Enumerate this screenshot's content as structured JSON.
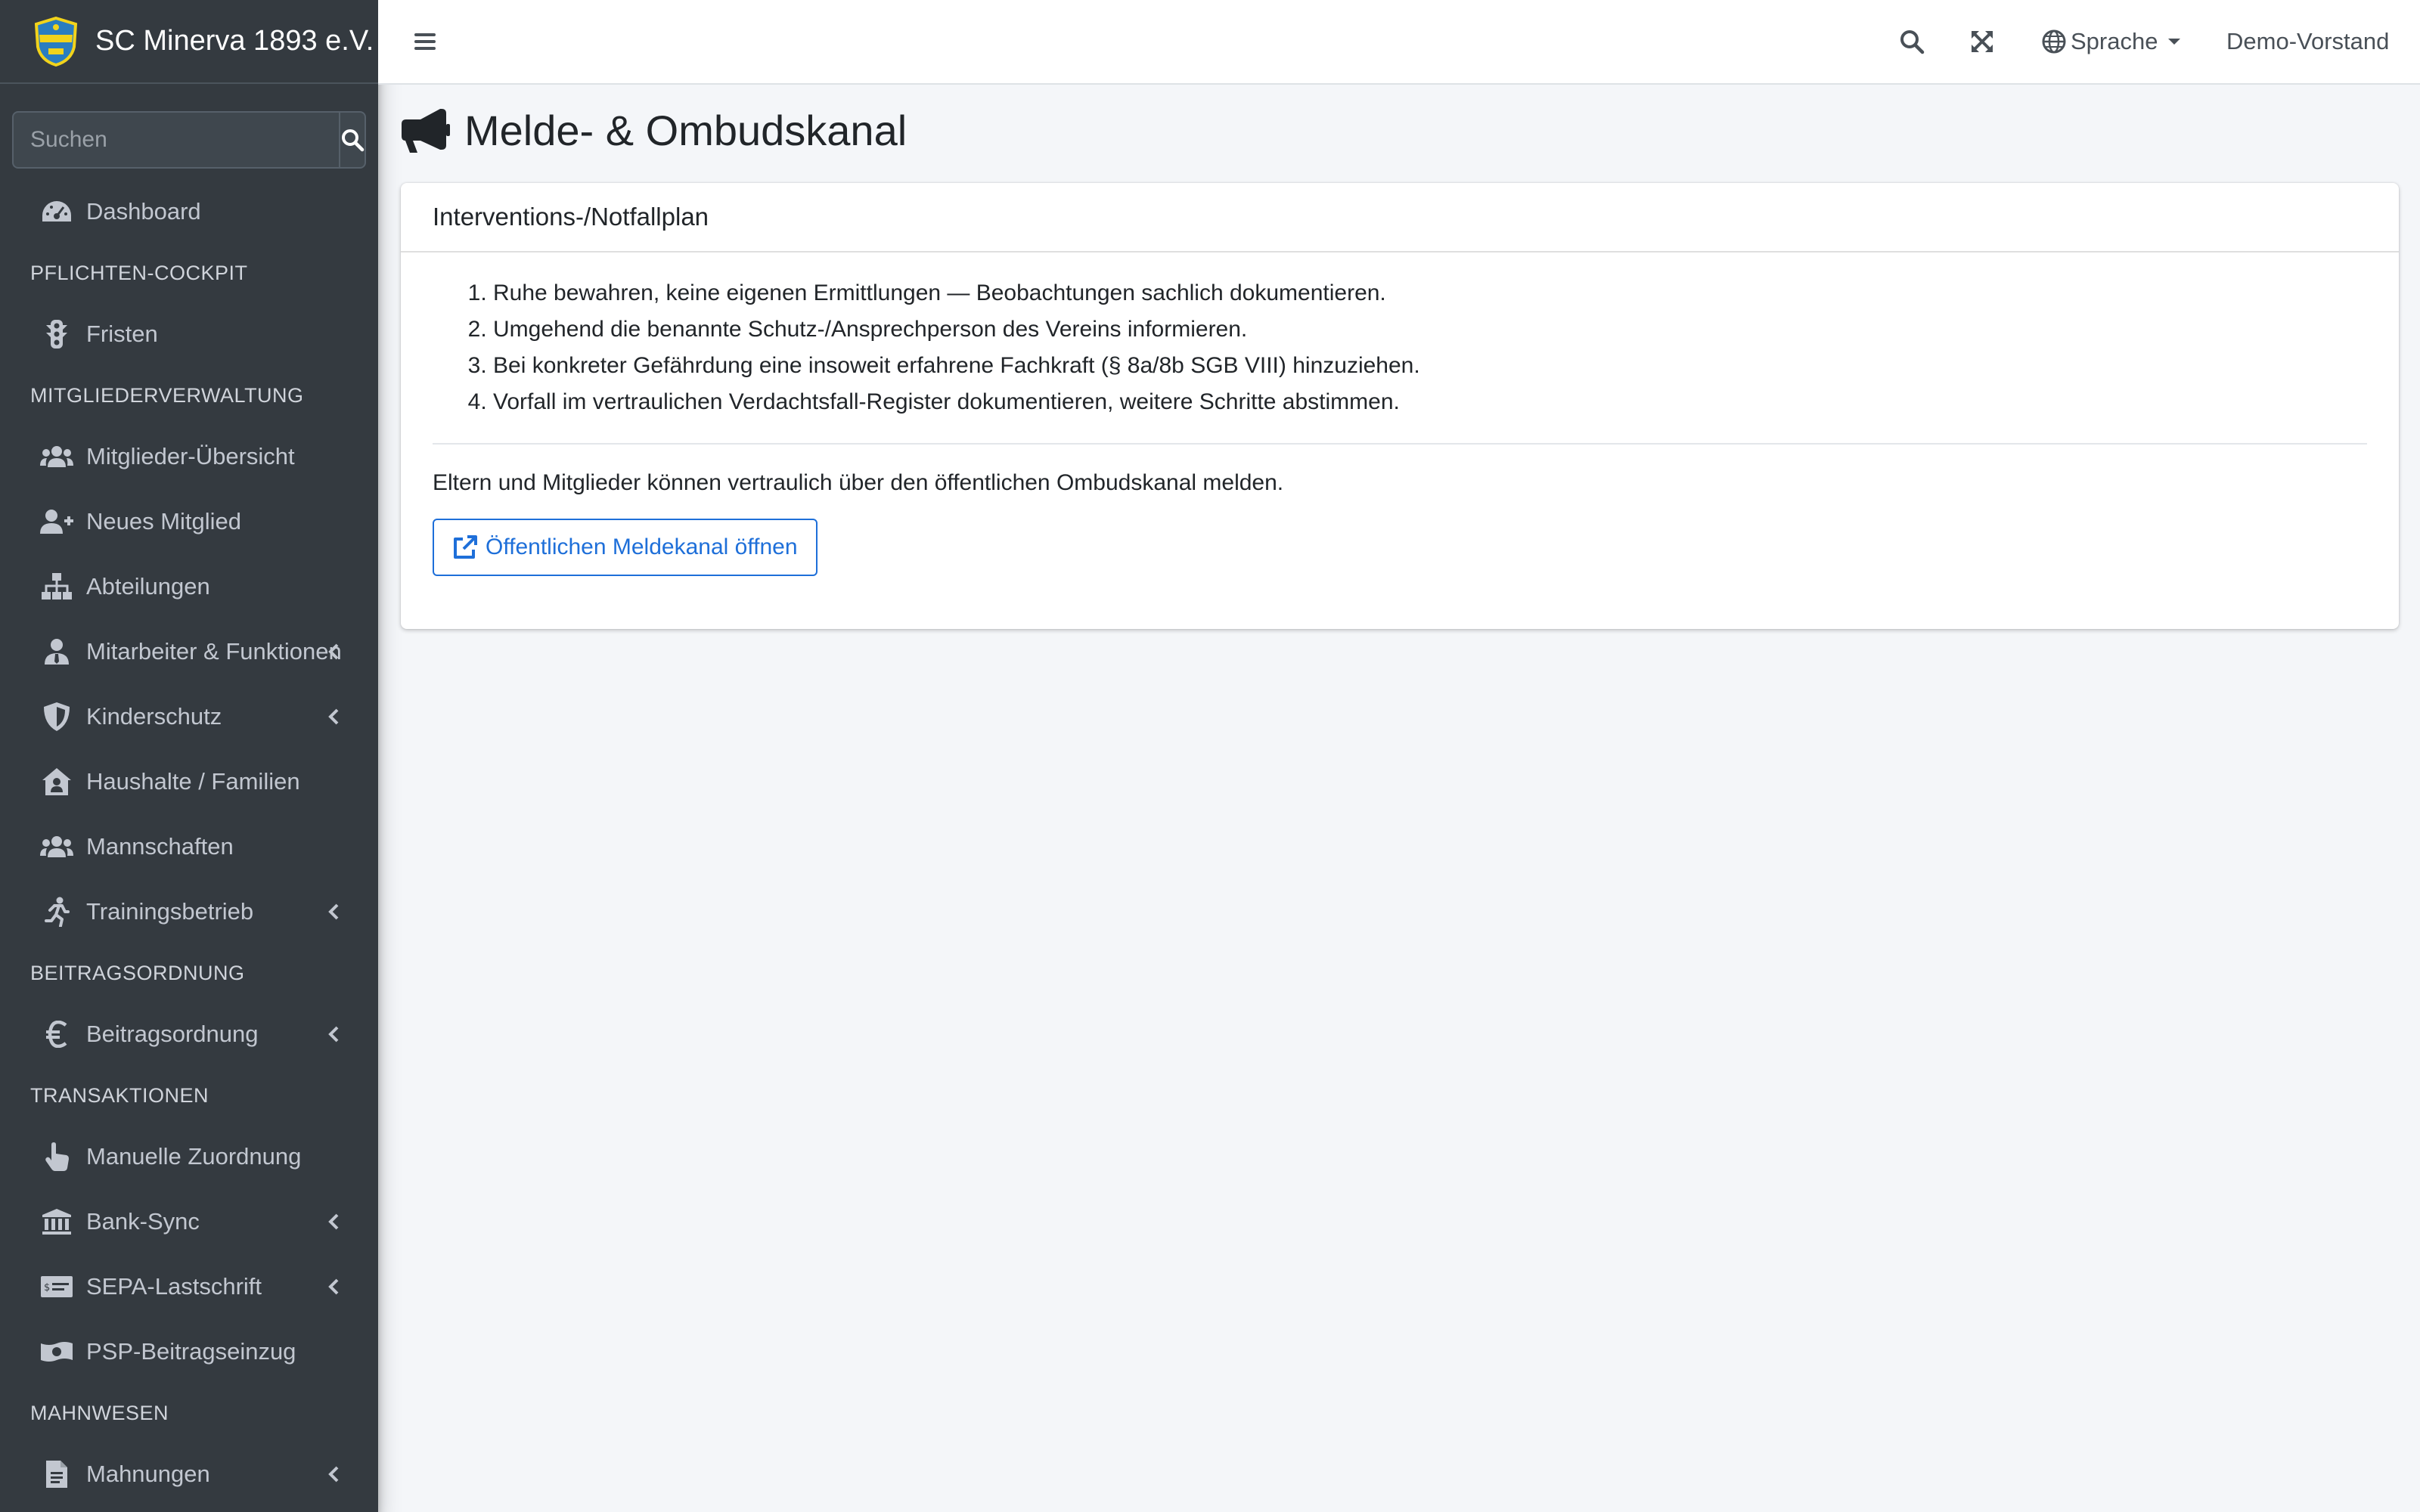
{
  "brand": {
    "name": "SC Minerva 1893 e.V."
  },
  "sidebar": {
    "search_placeholder": "Suchen",
    "items": [
      {
        "type": "item",
        "label": "Dashboard",
        "icon": "tachometer-icon",
        "chevron": false
      },
      {
        "type": "header",
        "label": "PFLICHTEN-COCKPIT"
      },
      {
        "type": "item",
        "label": "Fristen",
        "icon": "traffic-light-icon",
        "chevron": false
      },
      {
        "type": "header",
        "label": "MITGLIEDERVERWALTUNG"
      },
      {
        "type": "item",
        "label": "Mitglieder-Übersicht",
        "icon": "users-icon",
        "chevron": false
      },
      {
        "type": "item",
        "label": "Neues Mitglied",
        "icon": "user-plus-icon",
        "chevron": false
      },
      {
        "type": "item",
        "label": "Abteilungen",
        "icon": "sitemap-icon",
        "chevron": false
      },
      {
        "type": "item",
        "label": "Mitarbeiter & Funktionen",
        "icon": "user-tie-icon",
        "chevron": true
      },
      {
        "type": "item",
        "label": "Kinderschutz",
        "icon": "shield-icon",
        "chevron": true
      },
      {
        "type": "item",
        "label": "Haushalte / Familien",
        "icon": "house-user-icon",
        "chevron": false
      },
      {
        "type": "item",
        "label": "Mannschaften",
        "icon": "team-icon",
        "chevron": false
      },
      {
        "type": "item",
        "label": "Trainingsbetrieb",
        "icon": "running-icon",
        "chevron": true
      },
      {
        "type": "header",
        "label": "BEITRAGSORDNUNG"
      },
      {
        "type": "item",
        "label": "Beitragsordnung",
        "icon": "euro-icon",
        "chevron": true
      },
      {
        "type": "header",
        "label": "TRANSAKTIONEN"
      },
      {
        "type": "item",
        "label": "Manuelle Zuordnung",
        "icon": "hand-pointer-icon",
        "chevron": false
      },
      {
        "type": "item",
        "label": "Bank-Sync",
        "icon": "bank-icon",
        "chevron": true
      },
      {
        "type": "item",
        "label": "SEPA-Lastschrift",
        "icon": "money-check-icon",
        "chevron": true
      },
      {
        "type": "item",
        "label": "PSP-Beitragseinzug",
        "icon": "money-bill-icon",
        "chevron": false
      },
      {
        "type": "header",
        "label": "MAHNWESEN"
      },
      {
        "type": "item",
        "label": "Mahnungen",
        "icon": "file-alt-icon",
        "chevron": true
      }
    ]
  },
  "topbar": {
    "language_label": "Sprache",
    "user_label": "Demo-Vorstand"
  },
  "page": {
    "title": "Melde- & Ombudskanal",
    "card_title": "Interventions-/Notfallplan",
    "plan_steps": [
      "Ruhe bewahren, keine eigenen Ermittlungen — Beobachtungen sachlich dokumentieren.",
      "Umgehend die benannte Schutz-/Ansprechperson des Vereins informieren.",
      "Bei konkreter Gefährdung eine insoweit erfahrene Fachkraft (§ 8a/8b SGB VIII) hinzuziehen.",
      "Vorfall im vertraulichen Verdachtsfall-Register dokumentieren, weitere Schritte abstimmen."
    ],
    "description": "Eltern und Mitglieder können vertraulich über den öffentlichen Ombudskanal melden.",
    "open_button_label": "Öffentlichen Meldekanal öffnen"
  },
  "colors": {
    "sidebar_bg": "#343a40",
    "sidebar_text": "#c2c7d0",
    "content_bg": "#f4f6f9",
    "primary": "#1e6fd9",
    "logo_yellow": "#f2d31b",
    "logo_blue": "#2a7dc0"
  }
}
